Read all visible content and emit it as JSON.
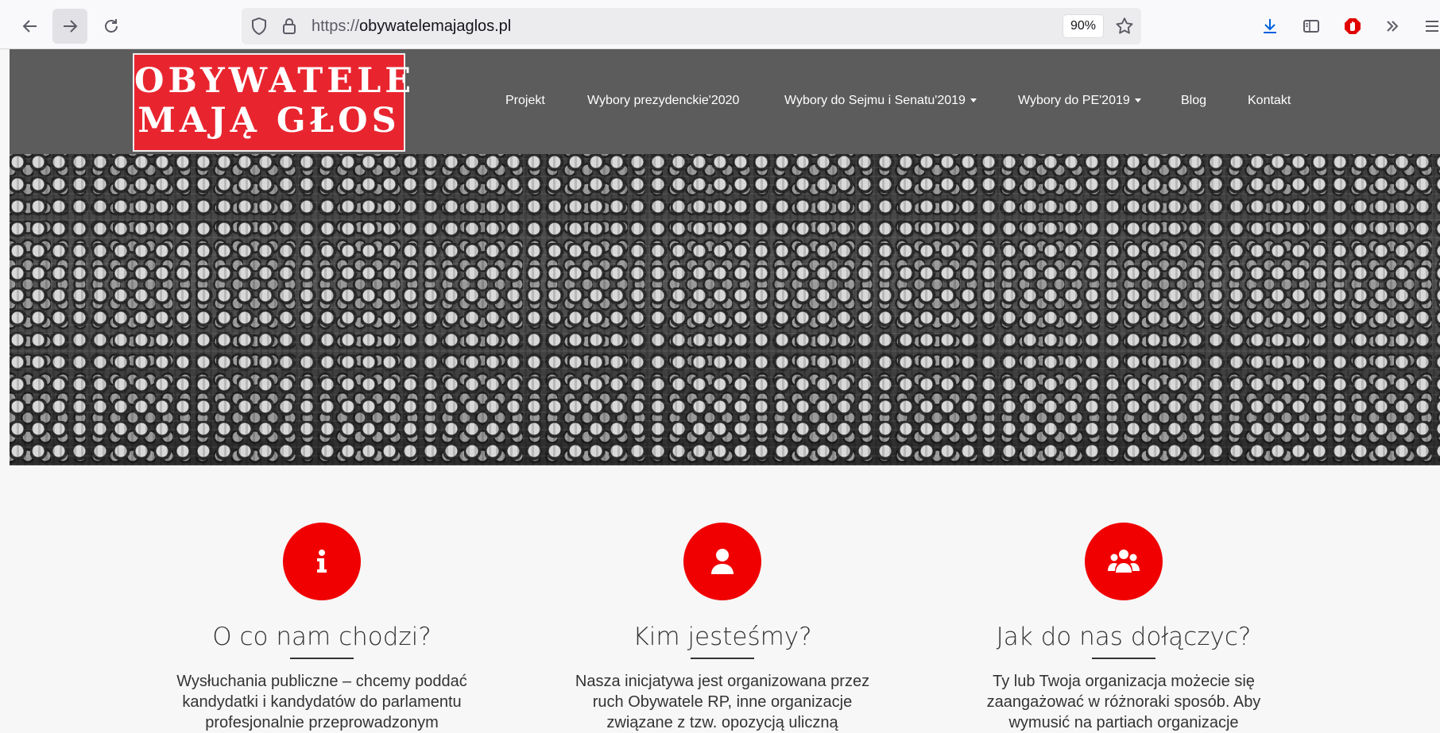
{
  "browser": {
    "url_protocol": "https://",
    "url_domain": "obywatelemajaglos.pl",
    "zoom": "90%"
  },
  "logo": {
    "line1": "OBYWATELE",
    "line2": "MAJĄ GŁOS",
    "background": "#e8252f"
  },
  "nav": {
    "items": [
      {
        "label": "Projekt"
      },
      {
        "label": "Wybory prezydenckie'2020"
      },
      {
        "label": "Wybory do Sejmu i Senatu'2019"
      },
      {
        "label": "Wybory do PE'2019"
      },
      {
        "label": "Blog"
      },
      {
        "label": "Kontakt"
      }
    ]
  },
  "features": [
    {
      "icon": "info-icon",
      "title": "O co nam chodzi?",
      "text": "Wysłuchania publiczne – chcemy poddać kandydatki i kandydatów do parlamentu profesjonalnie przeprowadzonym"
    },
    {
      "icon": "user-icon",
      "title": "Kim jesteśmy?",
      "text": "Nasza inicjatywa jest organizowana przez ruch Obywatele RP, inne organizacje związane z tzw. opozycją uliczną"
    },
    {
      "icon": "users-icon",
      "title": "Jak do nas dołączyc?",
      "text": "Ty lub Twoja organizacja możecie się zaangażować w różnoraki sposób. Aby wymusić na partiach organizacje"
    }
  ],
  "colors": {
    "accent": "#f00000",
    "header": "#5c5c5c"
  }
}
